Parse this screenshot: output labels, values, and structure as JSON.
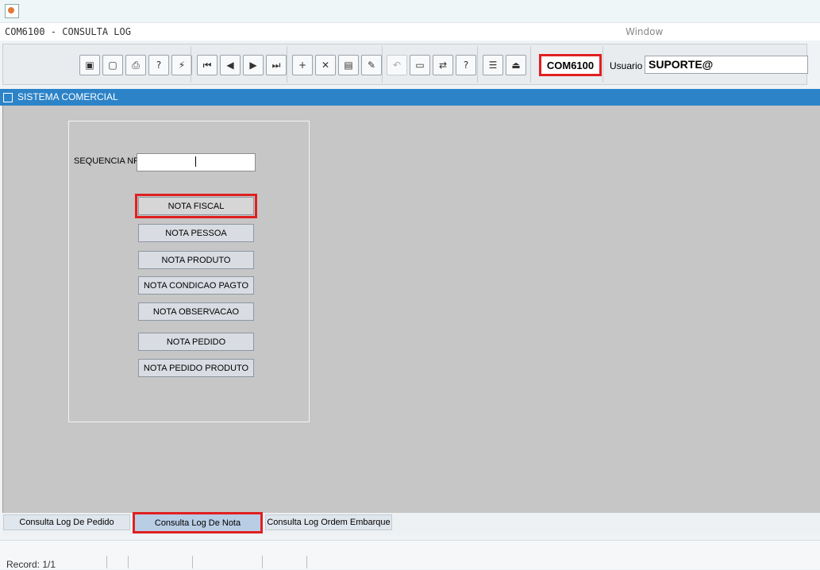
{
  "window": {
    "title": "COM6100 - CONSULTA LOG",
    "menu": "Window"
  },
  "toolbar": {
    "group1": [
      "save-icon",
      "print-preview-icon",
      "printer-icon",
      "help-query-icon",
      "execute-icon"
    ],
    "nav": [
      "first-record-icon",
      "previous-record-icon",
      "next-record-icon",
      "last-record-icon"
    ],
    "edit": [
      "insert-record-icon",
      "delete-record-icon",
      "list-values-icon",
      "clear-icon"
    ],
    "misc": [
      "undo-icon",
      "clipboard-icon",
      "transfer-icon",
      "help-icon"
    ],
    "menu_icons": [
      "menu-icon",
      "exit-icon"
    ],
    "form_code": "COM6100",
    "user_label": "Usuario",
    "user_value": "SUPORTE@"
  },
  "section": {
    "title": "SISTEMA COMERCIAL"
  },
  "form": {
    "seq_label": "SEQUENCIA NF",
    "seq_value": "",
    "buttons": {
      "nota_fiscal": "NOTA FISCAL",
      "nota_pessoa": "NOTA PESSOA",
      "nota_produto": "NOTA PRODUTO",
      "nota_condicao": "NOTA CONDICAO PAGTO",
      "nota_observacao": "NOTA OBSERVACAO",
      "nota_pedido": "NOTA PEDIDO",
      "nota_pedido_produto": "NOTA PEDIDO PRODUTO"
    }
  },
  "tabs": {
    "pedido": "Consulta Log De Pedido",
    "nota": "Consulta Log De Nota",
    "ordem": "Consulta Log Ordem Embarque"
  },
  "status": {
    "record": "Record: 1/1"
  },
  "colors": {
    "highlight": "#e02020",
    "section_bar": "#2c83c7",
    "canvas": "#c6c6c6"
  }
}
